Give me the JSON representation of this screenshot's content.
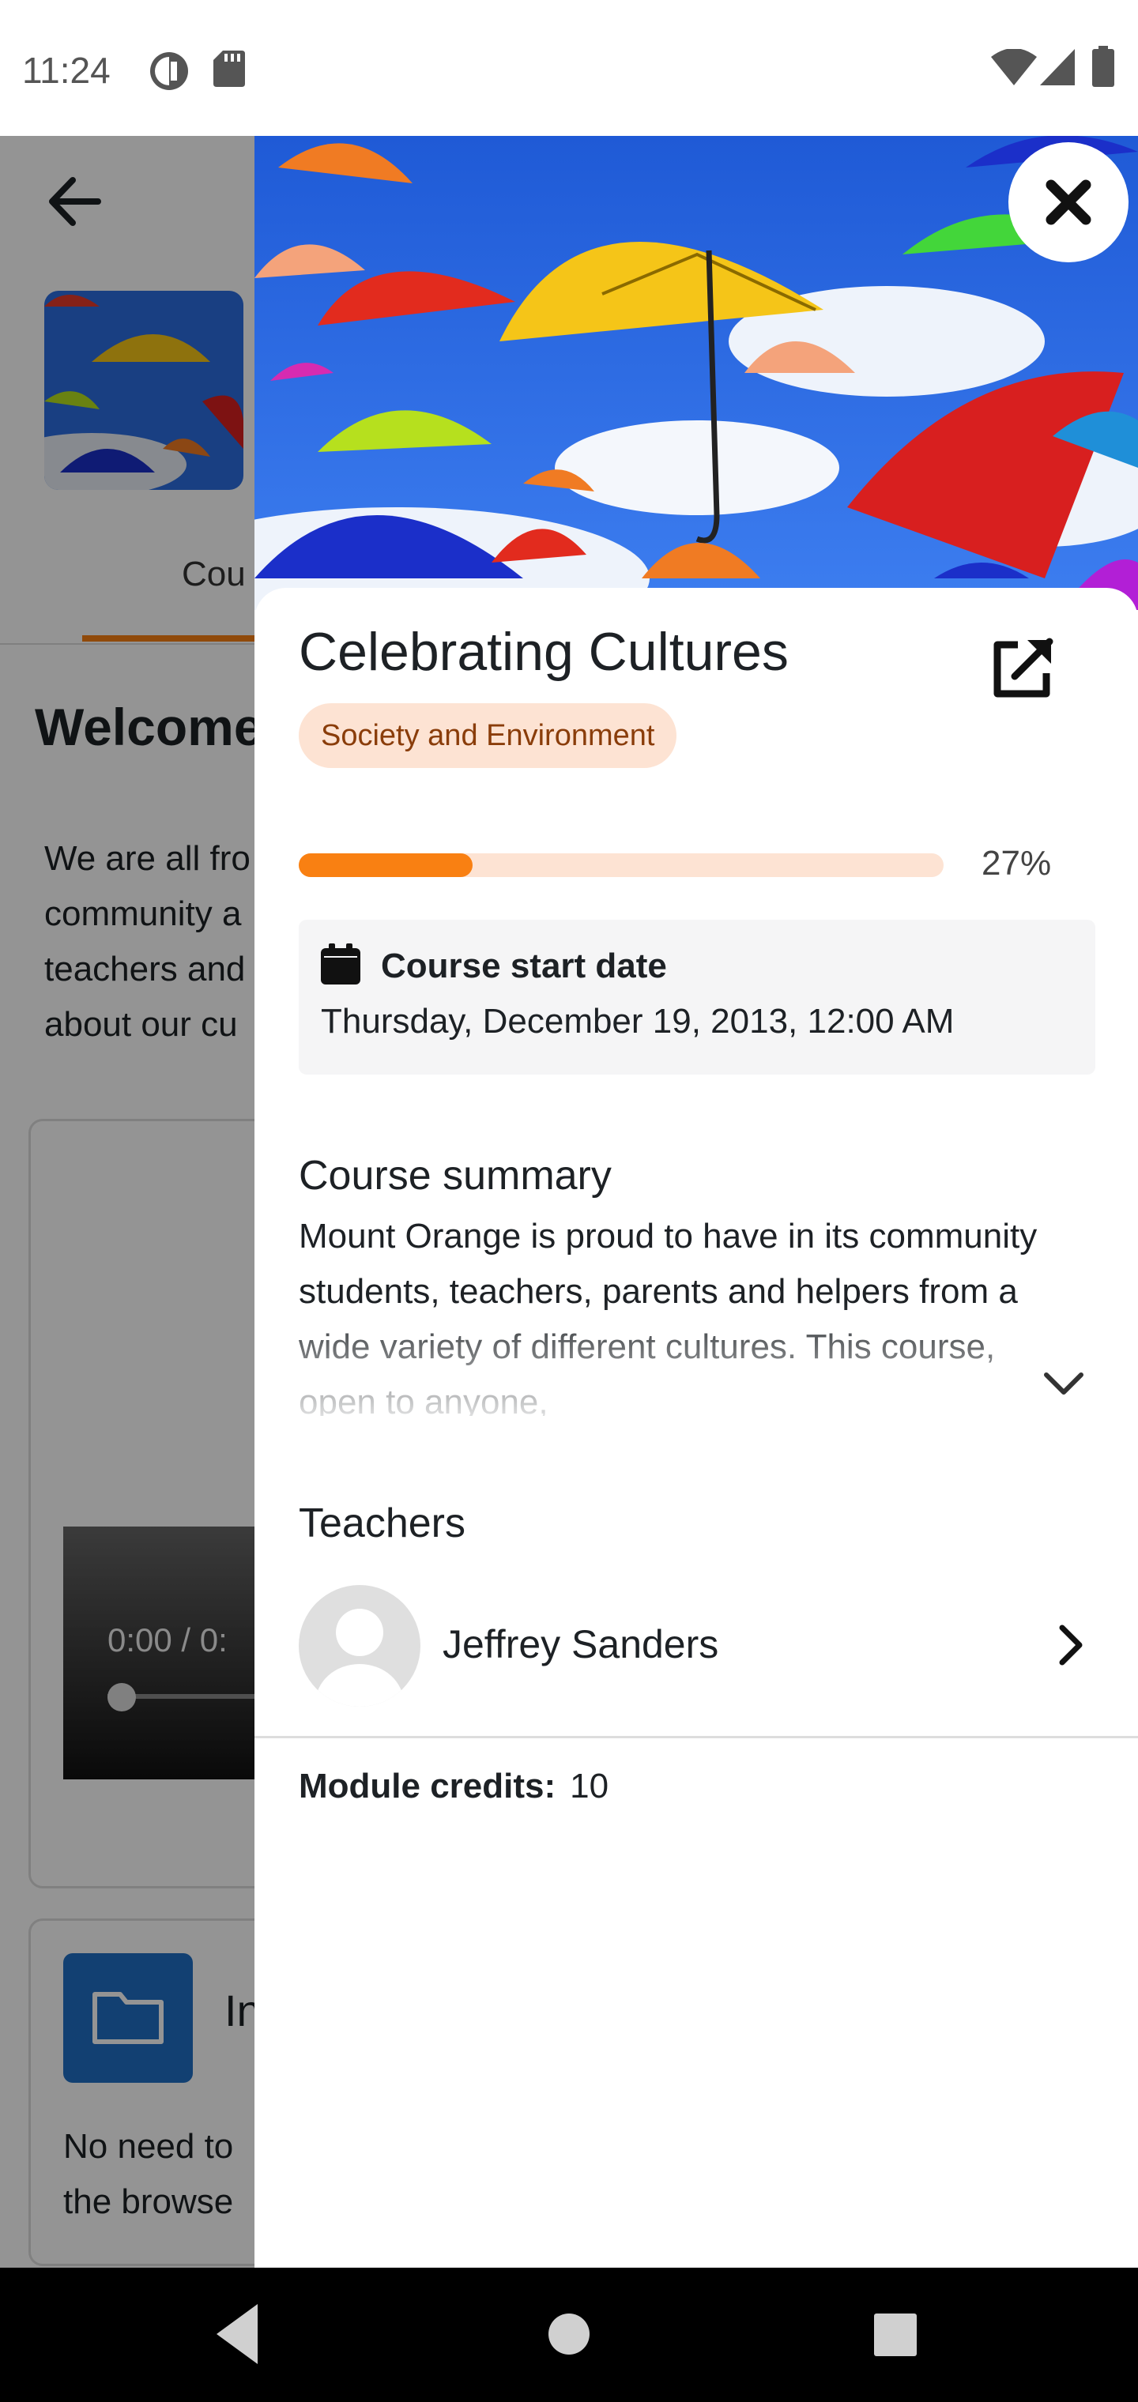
{
  "status_bar": {
    "time": "11:24",
    "left_icons": [
      "sync-icon",
      "sd-card-icon"
    ],
    "right_icons": [
      "wifi-icon",
      "signal-icon",
      "battery-icon"
    ]
  },
  "background_page": {
    "tab_label": "Cou",
    "welcome_heading": "Welcome",
    "intro_lines": [
      "We are all fro",
      "community a",
      "teachers and",
      "about our cu"
    ],
    "video_time": "0:00 / 0:",
    "folder_name": "In",
    "folder_text_lines": [
      "No need to",
      "the browse"
    ]
  },
  "panel": {
    "close_label": "Close",
    "course_title": "Celebrating Cultures",
    "open_link_icon": "external-link-icon",
    "category": "Society and Environment",
    "progress": {
      "percent": 27,
      "label": "27%"
    },
    "start_date": {
      "label": "Course start date",
      "value": "Thursday, December 19, 2013, 12:00 AM"
    },
    "summary": {
      "heading": "Course summary",
      "text": "Mount Orange is proud to have in its community students, teachers, parents and helpers from a wide variety of different cultures. This course, open to anyone,"
    },
    "teachers": {
      "heading": "Teachers",
      "items": [
        {
          "name": "Jeffrey Sanders"
        }
      ]
    },
    "credits": {
      "label": "Module credits:",
      "value": "10"
    }
  },
  "colors": {
    "accent": "#f98012",
    "badge_bg": "#fde3d3",
    "badge_text": "#8a3d0a",
    "date_box_bg": "#f5f5f6"
  }
}
